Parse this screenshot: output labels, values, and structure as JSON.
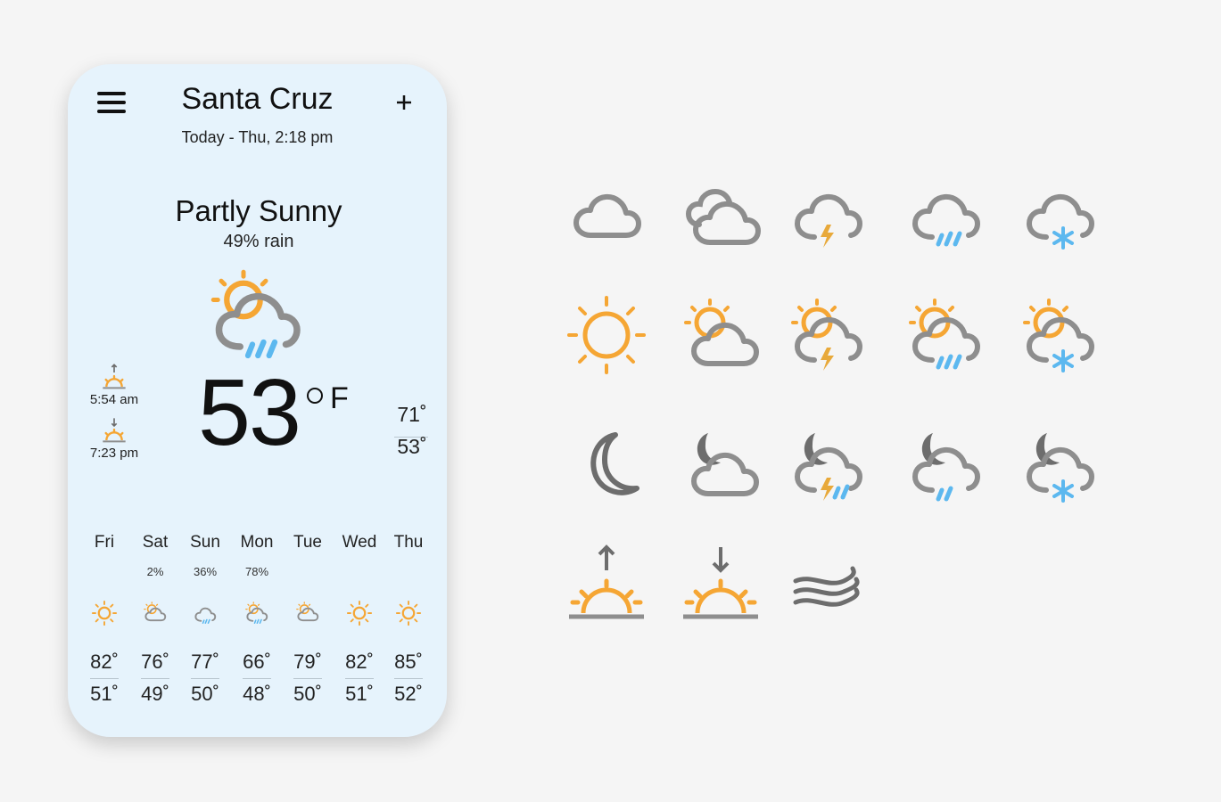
{
  "app": {
    "city": "Santa Cruz",
    "date": "Today - Thu, 2:18 pm",
    "icon_menu": "hamburger-menu-icon",
    "icon_add": "plus-icon"
  },
  "current": {
    "condition": "Partly Sunny",
    "rain": "49% rain",
    "temperature": "53",
    "unit": "F",
    "high": "71˚",
    "low": "53˚",
    "icon": "partly-sunny-rain-icon",
    "sunrise": "5:54 am",
    "sunset": "7:23 pm"
  },
  "forecast": [
    {
      "day": "Fri",
      "rain": "",
      "icon": "sun",
      "high": "82˚",
      "low": "51˚"
    },
    {
      "day": "Sat",
      "rain": "2%",
      "icon": "partly-cloudy",
      "high": "76˚",
      "low": "49˚"
    },
    {
      "day": "Sun",
      "rain": "36%",
      "icon": "rain",
      "high": "77˚",
      "low": "50˚"
    },
    {
      "day": "Mon",
      "rain": "78%",
      "icon": "sun-rain",
      "high": "66˚",
      "low": "48˚"
    },
    {
      "day": "Tue",
      "rain": "",
      "icon": "partly-cloudy",
      "high": "79˚",
      "low": "50˚"
    },
    {
      "day": "Wed",
      "rain": "",
      "icon": "sun",
      "high": "82˚",
      "low": "51˚"
    },
    {
      "day": "Thu",
      "rain": "",
      "icon": "sun",
      "high": "85˚",
      "low": "52˚"
    }
  ],
  "icon_library": [
    [
      "cloud-icon",
      "clouds-icon",
      "cloud-thunder-icon",
      "cloud-rain-icon",
      "cloud-snow-icon"
    ],
    [
      "sun-icon",
      "sun-cloud-icon",
      "sun-thunder-icon",
      "sun-rain-icon",
      "sun-snow-icon"
    ],
    [
      "moon-icon",
      "moon-cloud-icon",
      "moon-thunder-rain-icon",
      "moon-rain-icon",
      "moon-snow-icon"
    ],
    [
      "sunrise-icon",
      "sunset-icon",
      "wind-icon"
    ]
  ],
  "colors": {
    "background": "#f5f5f5",
    "card": "#e6f3fc",
    "sun": "#f5a634",
    "cloud": "#8e8e8e",
    "moon": "#6d6d6d",
    "rain": "#5cb8ef",
    "bolt": "#e8a93a"
  }
}
